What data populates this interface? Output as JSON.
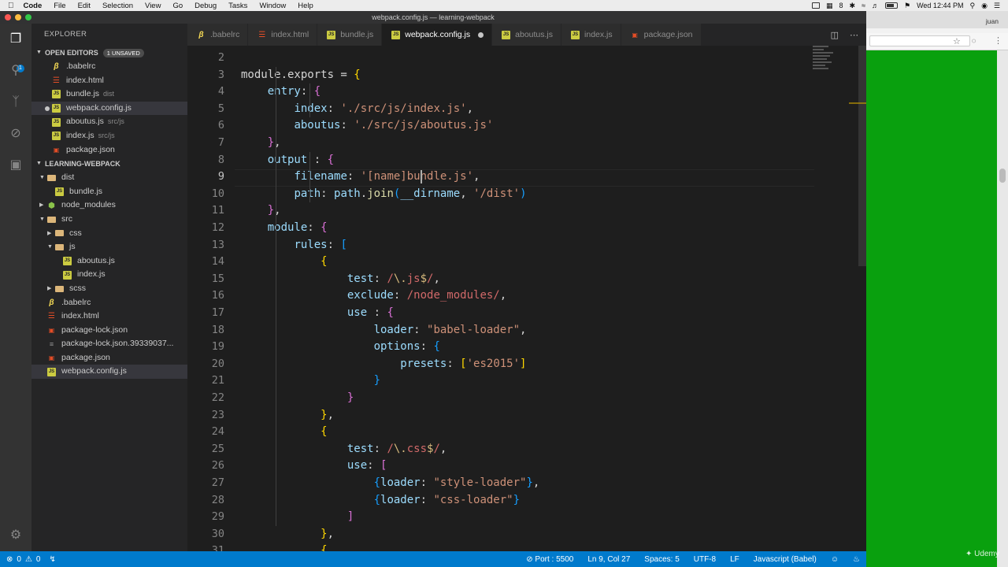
{
  "menubar": {
    "app": "Code",
    "items": [
      "File",
      "Edit",
      "Selection",
      "View",
      "Go",
      "Debug",
      "Tasks",
      "Window",
      "Help"
    ],
    "notif_count": "8",
    "clock": "Wed 12:44 PM"
  },
  "window": {
    "title": "webpack.config.js — learning-webpack"
  },
  "activity": {
    "scm_badge": "1"
  },
  "sidebar": {
    "title": "EXPLORER",
    "open_editors": {
      "label": "OPEN EDITORS",
      "badge": "1 UNSAVED",
      "items": [
        {
          "name": ".babelrc",
          "desc": "",
          "type": "babel"
        },
        {
          "name": "index.html",
          "desc": "",
          "type": "html"
        },
        {
          "name": "bundle.js",
          "desc": "dist",
          "type": "js"
        },
        {
          "name": "webpack.config.js",
          "desc": "",
          "type": "js"
        },
        {
          "name": "aboutus.js",
          "desc": "src/js",
          "type": "js"
        },
        {
          "name": "index.js",
          "desc": "src/js",
          "type": "js"
        },
        {
          "name": "package.json",
          "desc": "",
          "type": "jsonr"
        }
      ]
    },
    "project": {
      "label": "LEARNING-WEBPACK",
      "items": [
        {
          "name": "dist",
          "depth": 1,
          "kind": "folder",
          "open": true
        },
        {
          "name": "bundle.js",
          "depth": 2,
          "kind": "js"
        },
        {
          "name": "node_modules",
          "depth": 1,
          "kind": "nodefolder",
          "open": false
        },
        {
          "name": "src",
          "depth": 1,
          "kind": "folder",
          "open": true
        },
        {
          "name": "css",
          "depth": 2,
          "kind": "folder",
          "open": false
        },
        {
          "name": "js",
          "depth": 2,
          "kind": "folder",
          "open": true
        },
        {
          "name": "aboutus.js",
          "depth": 3,
          "kind": "js"
        },
        {
          "name": "index.js",
          "depth": 3,
          "kind": "js"
        },
        {
          "name": "scss",
          "depth": 2,
          "kind": "folder",
          "open": false
        },
        {
          "name": ".babelrc",
          "depth": 1,
          "kind": "babel"
        },
        {
          "name": "index.html",
          "depth": 1,
          "kind": "html"
        },
        {
          "name": "package-lock.json",
          "depth": 1,
          "kind": "jsonr"
        },
        {
          "name": "package-lock.json.39339037...",
          "depth": 1,
          "kind": "txt"
        },
        {
          "name": "package.json",
          "depth": 1,
          "kind": "jsonr"
        },
        {
          "name": "webpack.config.js",
          "depth": 1,
          "kind": "js"
        }
      ]
    }
  },
  "tabs": [
    {
      "label": ".babelrc",
      "type": "babel",
      "active": false
    },
    {
      "label": "index.html",
      "type": "html",
      "active": false
    },
    {
      "label": "bundle.js",
      "type": "js",
      "active": false
    },
    {
      "label": "webpack.config.js",
      "type": "js",
      "active": true
    },
    {
      "label": "aboutus.js",
      "type": "js",
      "active": false
    },
    {
      "label": "index.js",
      "type": "js",
      "active": false
    },
    {
      "label": "package.json",
      "type": "jsonr",
      "active": false
    }
  ],
  "editor": {
    "current_line": 9,
    "lines": [
      {
        "n": 2,
        "segs": []
      },
      {
        "n": 3,
        "segs": [
          [
            "p",
            "module.exports = "
          ],
          [
            "b1",
            "{"
          ]
        ]
      },
      {
        "n": 4,
        "segs": [
          [
            "p",
            "    "
          ],
          [
            "key",
            "entry"
          ],
          [
            "p",
            ": "
          ],
          [
            "b2",
            "{"
          ]
        ]
      },
      {
        "n": 5,
        "segs": [
          [
            "p",
            "        "
          ],
          [
            "key",
            "index"
          ],
          [
            "p",
            ": "
          ],
          [
            "str",
            "'./src/js/index.js'"
          ],
          [
            "p",
            ","
          ]
        ]
      },
      {
        "n": 6,
        "segs": [
          [
            "p",
            "        "
          ],
          [
            "key",
            "aboutus"
          ],
          [
            "p",
            ": "
          ],
          [
            "str",
            "'./src/js/aboutus.js'"
          ]
        ]
      },
      {
        "n": 7,
        "segs": [
          [
            "p",
            "    "
          ],
          [
            "b2",
            "}"
          ],
          [
            "p",
            ","
          ]
        ]
      },
      {
        "n": 8,
        "segs": [
          [
            "p",
            "    "
          ],
          [
            "key",
            "output"
          ],
          [
            "p",
            " : "
          ],
          [
            "b2",
            "{"
          ]
        ]
      },
      {
        "n": 9,
        "segs": [
          [
            "p",
            "        "
          ],
          [
            "key",
            "filename"
          ],
          [
            "p",
            ": "
          ],
          [
            "str",
            "'[name]bundle.js'"
          ],
          [
            "p",
            ","
          ]
        ]
      },
      {
        "n": 10,
        "segs": [
          [
            "p",
            "        "
          ],
          [
            "key",
            "path"
          ],
          [
            "p",
            ": "
          ],
          [
            "key",
            "path"
          ],
          [
            "p",
            "."
          ],
          [
            "fn",
            "join"
          ],
          [
            "b3",
            "("
          ],
          [
            "key",
            "__dirname"
          ],
          [
            "p",
            ", "
          ],
          [
            "str",
            "'/dist'"
          ],
          [
            "b3",
            ")"
          ]
        ]
      },
      {
        "n": 11,
        "segs": [
          [
            "p",
            "    "
          ],
          [
            "b2",
            "}"
          ],
          [
            "p",
            ","
          ]
        ]
      },
      {
        "n": 12,
        "segs": [
          [
            "p",
            "    "
          ],
          [
            "key",
            "module"
          ],
          [
            "p",
            ": "
          ],
          [
            "b2",
            "{"
          ]
        ]
      },
      {
        "n": 13,
        "segs": [
          [
            "p",
            "        "
          ],
          [
            "key",
            "rules"
          ],
          [
            "p",
            ": "
          ],
          [
            "b3",
            "["
          ]
        ]
      },
      {
        "n": 14,
        "segs": [
          [
            "p",
            "            "
          ],
          [
            "b1",
            "{"
          ]
        ]
      },
      {
        "n": 15,
        "segs": [
          [
            "p",
            "                "
          ],
          [
            "key",
            "test"
          ],
          [
            "p",
            ": "
          ],
          [
            "re",
            "/"
          ],
          [
            "esc",
            "\\."
          ],
          [
            "re",
            "js"
          ],
          [
            "esc",
            "$"
          ],
          [
            "re",
            "/"
          ],
          [
            "p",
            ","
          ]
        ]
      },
      {
        "n": 16,
        "segs": [
          [
            "p",
            "                "
          ],
          [
            "key",
            "exclude"
          ],
          [
            "p",
            ": "
          ],
          [
            "re",
            "/node_modules/"
          ],
          [
            "p",
            ","
          ]
        ]
      },
      {
        "n": 17,
        "segs": [
          [
            "p",
            "                "
          ],
          [
            "key",
            "use"
          ],
          [
            "p",
            " : "
          ],
          [
            "b2",
            "{"
          ]
        ]
      },
      {
        "n": 18,
        "segs": [
          [
            "p",
            "                    "
          ],
          [
            "key",
            "loader"
          ],
          [
            "p",
            ": "
          ],
          [
            "str",
            "\"babel-loader\""
          ],
          [
            "p",
            ","
          ]
        ]
      },
      {
        "n": 19,
        "segs": [
          [
            "p",
            "                    "
          ],
          [
            "key",
            "options"
          ],
          [
            "p",
            ": "
          ],
          [
            "b3",
            "{"
          ]
        ]
      },
      {
        "n": 20,
        "segs": [
          [
            "p",
            "                        "
          ],
          [
            "key",
            "presets"
          ],
          [
            "p",
            ": "
          ],
          [
            "b1",
            "["
          ],
          [
            "str",
            "'es2015'"
          ],
          [
            "b1",
            "]"
          ]
        ]
      },
      {
        "n": 21,
        "segs": [
          [
            "p",
            "                    "
          ],
          [
            "b3",
            "}"
          ]
        ]
      },
      {
        "n": 22,
        "segs": [
          [
            "p",
            "                "
          ],
          [
            "b2",
            "}"
          ]
        ]
      },
      {
        "n": 23,
        "segs": [
          [
            "p",
            "            "
          ],
          [
            "b1",
            "}"
          ],
          [
            "p",
            ","
          ]
        ]
      },
      {
        "n": 24,
        "segs": [
          [
            "p",
            "            "
          ],
          [
            "b1",
            "{"
          ]
        ]
      },
      {
        "n": 25,
        "segs": [
          [
            "p",
            "                "
          ],
          [
            "key",
            "test"
          ],
          [
            "p",
            ": "
          ],
          [
            "re",
            "/"
          ],
          [
            "esc",
            "\\."
          ],
          [
            "re",
            "css"
          ],
          [
            "esc",
            "$"
          ],
          [
            "re",
            "/"
          ],
          [
            "p",
            ","
          ]
        ]
      },
      {
        "n": 26,
        "segs": [
          [
            "p",
            "                "
          ],
          [
            "key",
            "use"
          ],
          [
            "p",
            ": "
          ],
          [
            "b2",
            "["
          ]
        ]
      },
      {
        "n": 27,
        "segs": [
          [
            "p",
            "                    "
          ],
          [
            "b3",
            "{"
          ],
          [
            "key",
            "loader"
          ],
          [
            "p",
            ": "
          ],
          [
            "str",
            "\"style-loader\""
          ],
          [
            "b3",
            "}"
          ],
          [
            "p",
            ","
          ]
        ]
      },
      {
        "n": 28,
        "segs": [
          [
            "p",
            "                    "
          ],
          [
            "b3",
            "{"
          ],
          [
            "key",
            "loader"
          ],
          [
            "p",
            ": "
          ],
          [
            "str",
            "\"css-loader\""
          ],
          [
            "b3",
            "}"
          ]
        ]
      },
      {
        "n": 29,
        "segs": [
          [
            "p",
            "                "
          ],
          [
            "b2",
            "]"
          ]
        ]
      },
      {
        "n": 30,
        "segs": [
          [
            "p",
            "            "
          ],
          [
            "b1",
            "}"
          ],
          [
            "p",
            ","
          ]
        ]
      },
      {
        "n": 31,
        "segs": [
          [
            "p",
            "            "
          ],
          [
            "b1",
            "{"
          ]
        ]
      }
    ]
  },
  "statusbar": {
    "errors": "0",
    "warnings": "0",
    "port": "Port : 5500",
    "position": "Ln 9, Col 27",
    "spaces": "Spaces: 5",
    "encoding": "UTF-8",
    "eol": "LF",
    "language": "Javascript (Babel)"
  },
  "browser": {
    "user": "juan",
    "page_color": "#09a00e"
  },
  "watermark": "Udemy",
  "colors": {
    "status": "#007acc",
    "editor_bg": "#1e1e1e",
    "sidebar_bg": "#252526",
    "activity_bg": "#333333"
  }
}
